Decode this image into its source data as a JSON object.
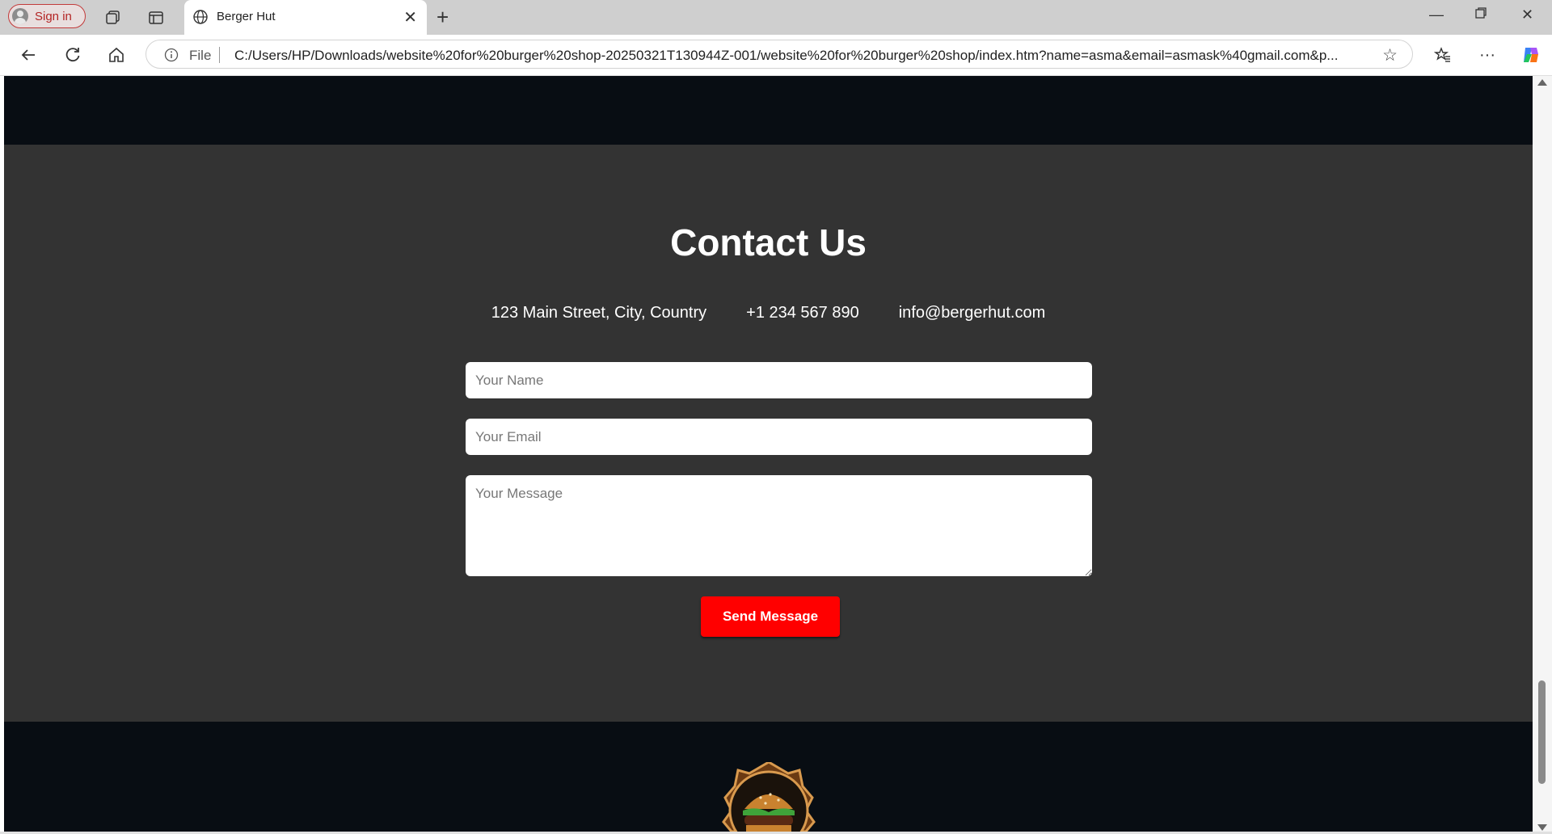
{
  "browser": {
    "signin_label": "Sign in",
    "tab_title": "Berger Hut",
    "address": {
      "scheme_label": "File",
      "url": "C:/Users/HP/Downloads/website%20for%20burger%20shop-20250321T130944Z-001/website%20for%20burger%20shop/index.htm?name=asma&email=asmask%40gmail.com&p..."
    }
  },
  "contact": {
    "heading": "Contact Us",
    "address": "123 Main Street, City, Country",
    "phone": "+1 234 567 890",
    "email": "info@bergerhut.com",
    "form": {
      "name_placeholder": "Your Name",
      "email_placeholder": "Your Email",
      "message_placeholder": "Your Message",
      "send_label": "Send Message"
    }
  },
  "colors": {
    "dark_band": "#080d13",
    "contact_bg": "#333333",
    "accent": "#ff0000"
  }
}
